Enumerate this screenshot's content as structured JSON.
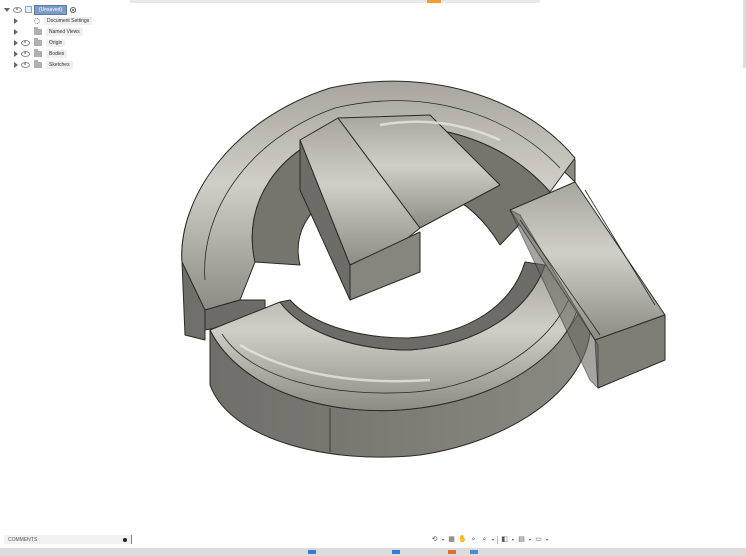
{
  "browser": {
    "document_name": "(Unsaved)",
    "items": [
      {
        "label": "Document Settings",
        "icon": "gear-icon"
      },
      {
        "label": "Named Views",
        "icon": "folder-icon"
      },
      {
        "label": "Origin",
        "icon": "folder-icon"
      },
      {
        "label": "Bodies",
        "icon": "folder-icon"
      },
      {
        "label": "Sketches",
        "icon": "folder-icon"
      }
    ]
  },
  "comments": {
    "label": "COMMENTS"
  },
  "nav_toolbar": {
    "buttons": [
      "orbit-icon",
      "look-at-icon",
      "pan-icon",
      "zoom-icon",
      "fit-icon",
      "display-settings-icon",
      "grid-settings-icon",
      "viewports-icon"
    ]
  },
  "model": {
    "description_icon": "refresh-arrows-3d-model",
    "colors": {
      "face": "#77766f",
      "top": "#9b9a92",
      "edge": "#2b2a26",
      "highlight": "#d8d7d0"
    }
  },
  "colors": {
    "accent_orange": "#f0a030",
    "doc_blue": "#7e9cc8"
  }
}
